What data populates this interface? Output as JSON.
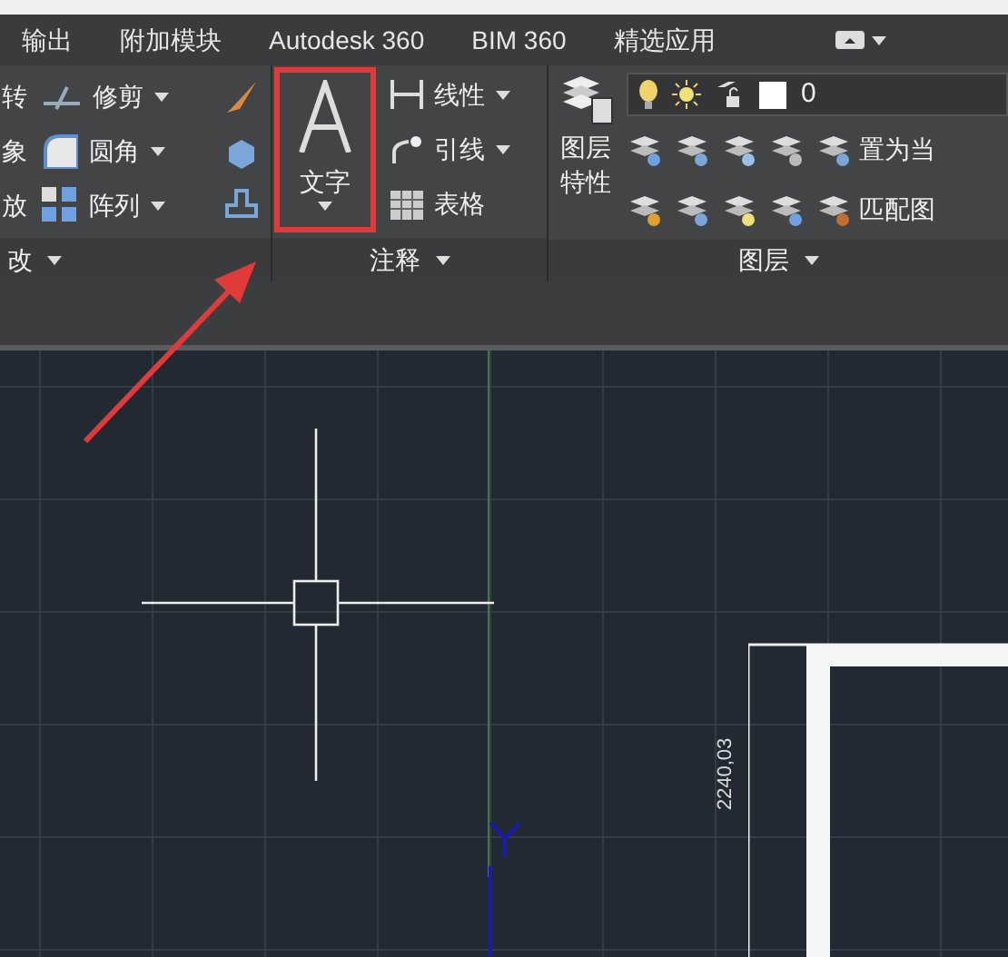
{
  "ribbon_tabs": [
    {
      "label": "输出"
    },
    {
      "label": "附加模块"
    },
    {
      "label": "Autodesk 360"
    },
    {
      "label": "BIM 360"
    },
    {
      "label": "精选应用"
    }
  ],
  "modify_panel": {
    "title": "改",
    "cut_labels": [
      "转",
      "象",
      "放"
    ],
    "tools": [
      {
        "label": "修剪",
        "dropdown": true
      },
      {
        "label": "圆角",
        "dropdown": true
      },
      {
        "label": "阵列",
        "dropdown": true
      }
    ]
  },
  "annotation_panel": {
    "title": "注释",
    "big_tool": {
      "label": "文字",
      "highlighted": true
    },
    "tools": [
      {
        "label": "线性",
        "dropdown": true
      },
      {
        "label": "引线",
        "dropdown": true
      },
      {
        "label": "表格",
        "dropdown": false
      }
    ]
  },
  "layers_panel": {
    "title": "图层",
    "properties_button": "图层特性",
    "current_layer": "0",
    "tools": [
      "置为当",
      "匹配图"
    ]
  },
  "drawing": {
    "dimension": "2240,03"
  }
}
